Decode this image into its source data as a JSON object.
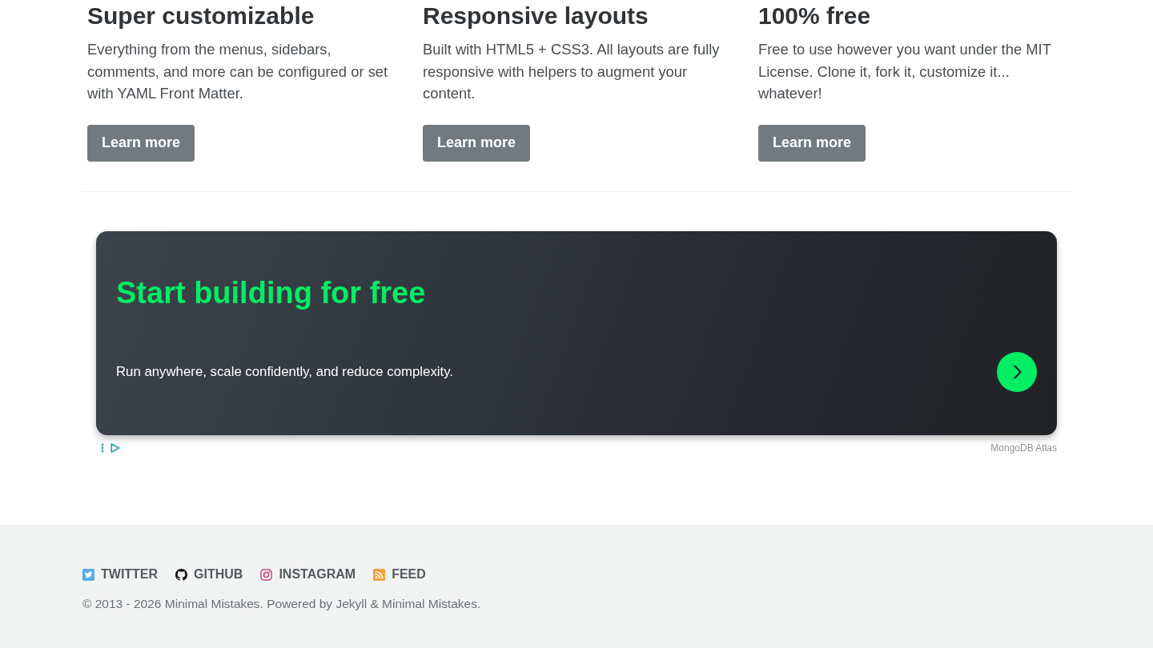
{
  "features": [
    {
      "title": "Super customizable",
      "text": "Everything from the menus, sidebars, comments, and more can be configured or set with YAML Front Matter.",
      "button": "Learn more"
    },
    {
      "title": "Responsive layouts",
      "text": "Built with HTML5 + CSS3. All layouts are fully responsive with helpers to augment your content.",
      "button": "Learn more"
    },
    {
      "title": "100% free",
      "text": "Free to use however you want under the MIT License. Clone it, fork it, customize it... whatever!",
      "button": "Learn more"
    }
  ],
  "ad": {
    "title": "Start building for free",
    "text": "Run anywhere, scale confidently, and reduce complexity.",
    "sponsor": "MongoDB Atlas"
  },
  "footer": {
    "links": [
      "TWITTER",
      "GITHUB",
      "INSTAGRAM",
      "FEED"
    ],
    "copyright": "© 2013 - 2026 Minimal Mistakes. Powered by Jekyll & Minimal Mistakes."
  }
}
